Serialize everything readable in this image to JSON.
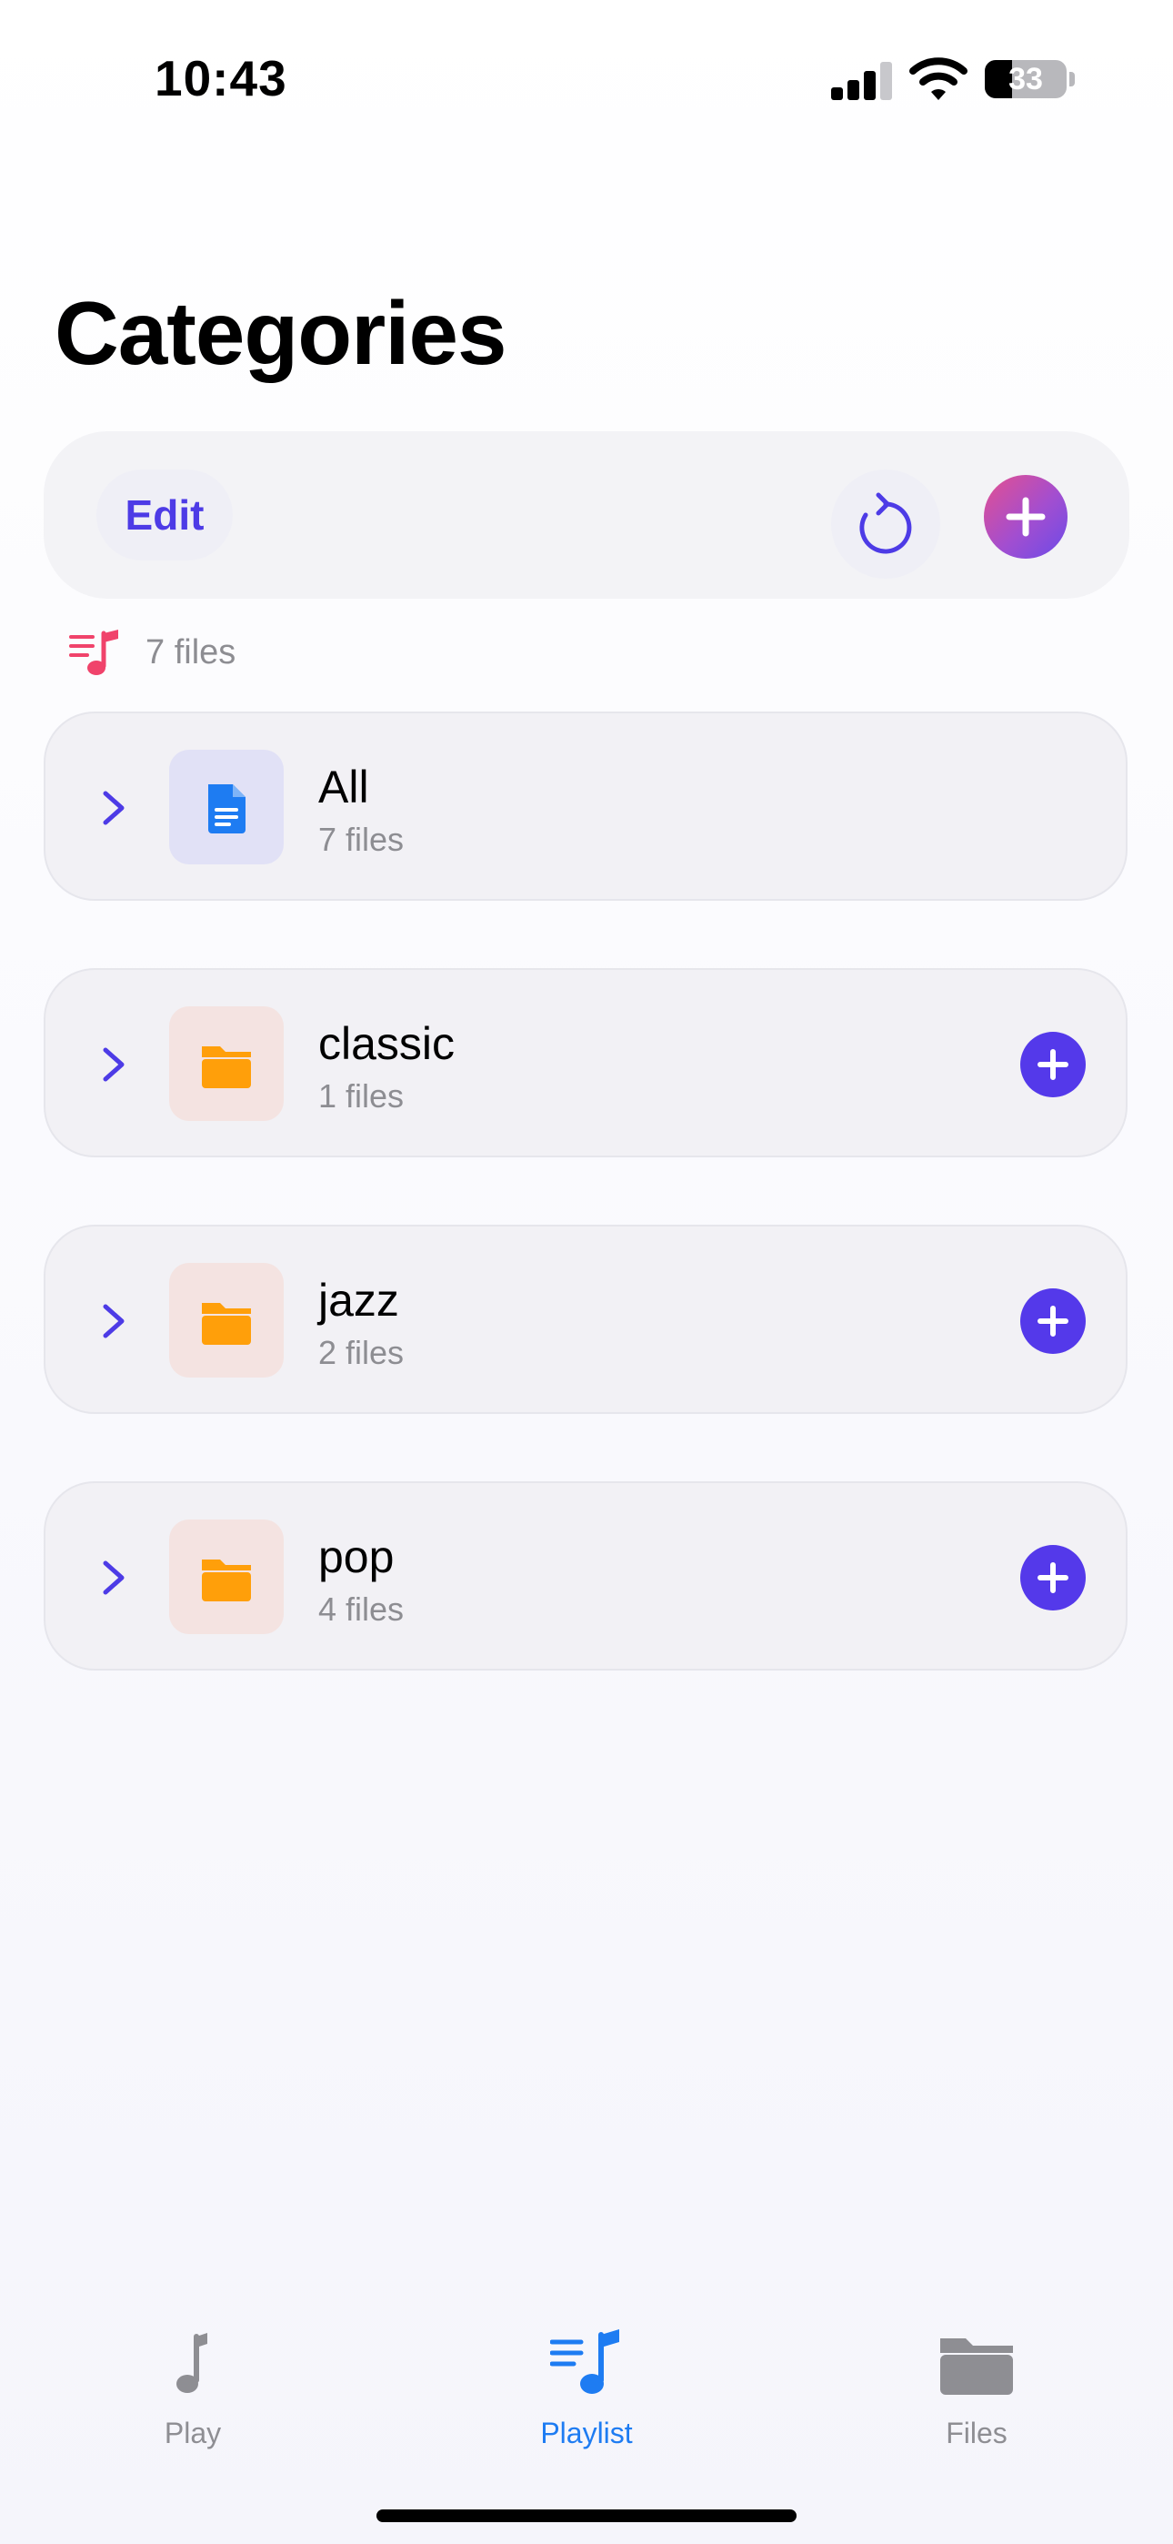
{
  "status_bar": {
    "time": "10:43",
    "battery_level": "33",
    "battery_fraction": 0.33
  },
  "page": {
    "title": "Categories"
  },
  "toolbar": {
    "edit_label": "Edit",
    "refresh_icon": "refresh-icon",
    "add_icon": "plus-icon",
    "add_gradient": [
      "#e5508f",
      "#6b4be8"
    ]
  },
  "summary": {
    "text": "7 files",
    "icon": "music-list-icon"
  },
  "categories": [
    {
      "name": "All",
      "count": "7 files",
      "icon": "document-icon",
      "has_add": false
    },
    {
      "name": "classic",
      "count": "1 files",
      "icon": "folder-icon",
      "has_add": true
    },
    {
      "name": "jazz",
      "count": "2 files",
      "icon": "folder-icon",
      "has_add": true
    },
    {
      "name": "pop",
      "count": "4 files",
      "icon": "folder-icon",
      "has_add": true
    }
  ],
  "tabbar": {
    "tabs": [
      {
        "label": "Play",
        "icon": "music-note-icon",
        "selected": false
      },
      {
        "label": "Playlist",
        "icon": "playlist-icon",
        "selected": true
      },
      {
        "label": "Files",
        "icon": "folder-icon",
        "selected": false
      }
    ]
  },
  "colors": {
    "accent": "#5439ea",
    "tab_selected": "#1e7cf2",
    "tab_unselected": "#8e8e93",
    "folder": "#ff9f0a",
    "document": "#1e7cf2",
    "summary_icon": "#f0436b"
  }
}
